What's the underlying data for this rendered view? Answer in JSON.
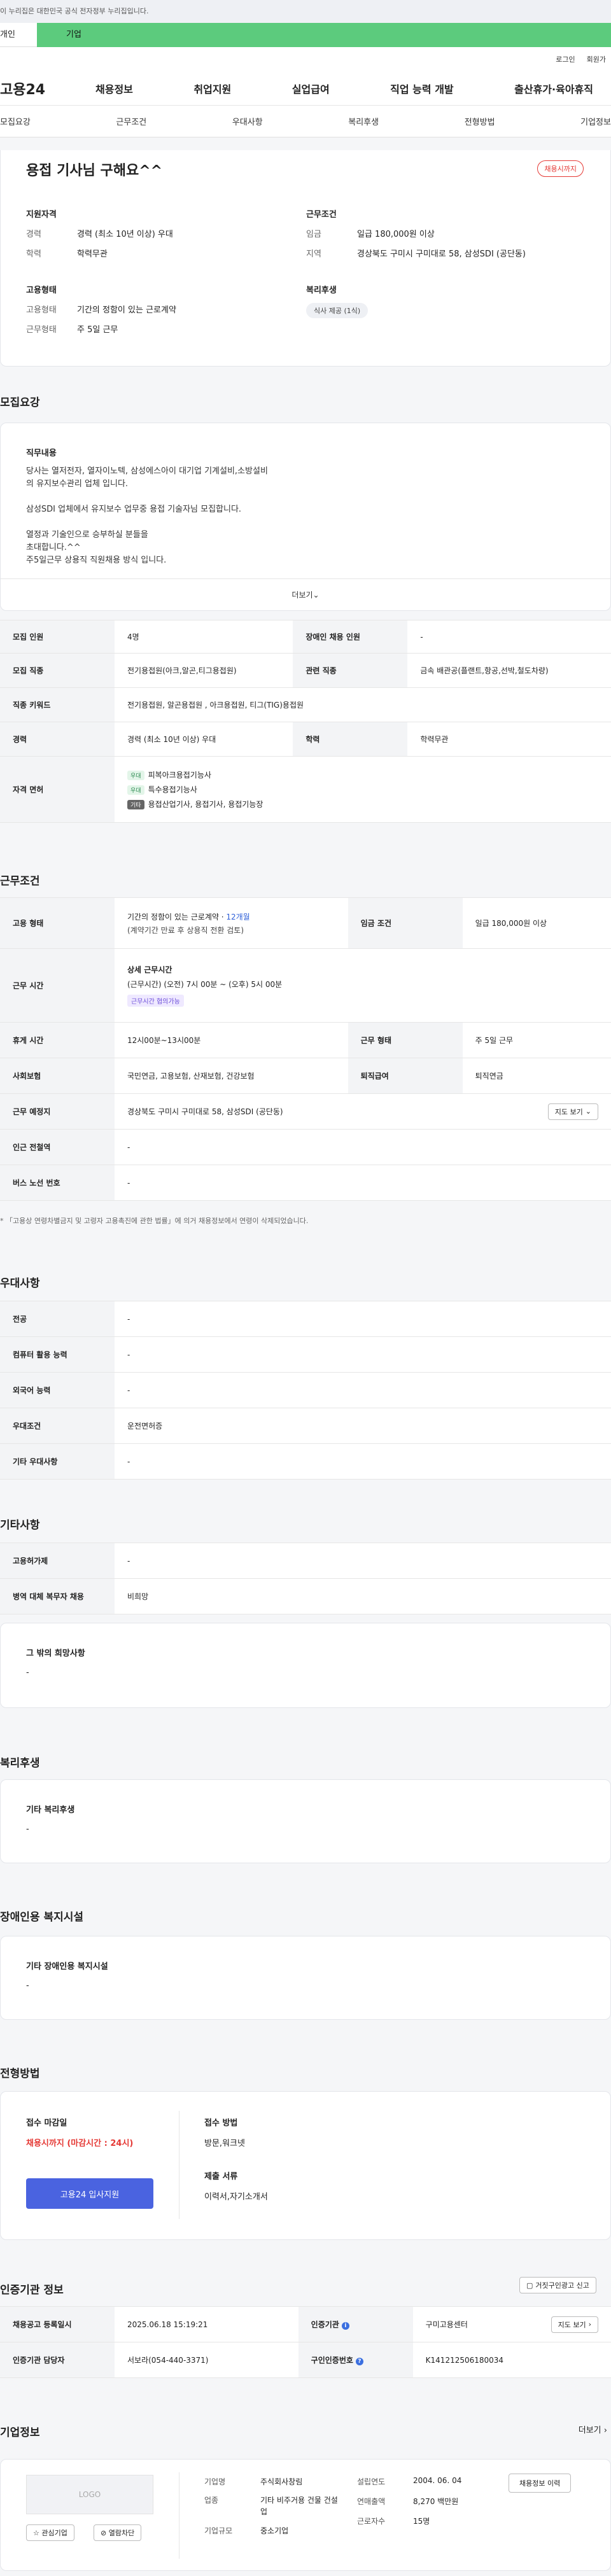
{
  "notice": "이 누리집은 대한민국 공식 전자정부 누리집입니다.",
  "tabs": {
    "individual": "개인",
    "company": "기업"
  },
  "util": {
    "login": "로그인",
    "join": "회원가"
  },
  "logo": "고용24",
  "gnb": [
    "채용정보",
    "취업지원",
    "실업급여",
    "직업 능력 개발",
    "출산휴가·육아휴직"
  ],
  "lnb": [
    "모집요강",
    "근무조건",
    "우대사항",
    "복리후생",
    "전형방법",
    "기업정보"
  ],
  "header": {
    "title": "용접 기사님 구해요^^",
    "status": "채용시까지",
    "qual_title": "지원자격",
    "qual": [
      {
        "k": "경력",
        "v": "경력 (최소 10년 이상) 우대"
      },
      {
        "k": "학력",
        "v": "학력무관"
      }
    ],
    "work_title": "근무조건",
    "work": [
      {
        "k": "임금",
        "v": "일급 180,000원 이상"
      },
      {
        "k": "지역",
        "v": "경상북도 구미시 구미대로 58, 삼성SDI (공단동)"
      }
    ],
    "emp_title": "고용형태",
    "emp": [
      {
        "k": "고용형태",
        "v": "기간의 정함이 있는 근로계약"
      },
      {
        "k": "근무형태",
        "v": "주 5일 근무"
      }
    ],
    "welfare_title": "복리후생",
    "welfare_chip": "식사 제공 (1식)"
  },
  "sections": {
    "recruit": "모집요강",
    "work": "근무조건",
    "prefer": "우대사항",
    "etc": "기타사항",
    "welfare": "복리후생",
    "disabled": "장애인용 복지시설",
    "apply": "전형방법",
    "cert": "인증기관 정보",
    "company": "기업정보"
  },
  "job_desc": {
    "title": "직무내용",
    "text": "당사는 열저전자, 열자이노텍, 삼성에스아이 대기업 기계설비,소방설비\n의 유지보수관리 업체 입니다.\n\n삼성SDI 업체에서 유지보수 업무중 용접 기술자님 모집합니다.\n\n열정과 기술인으로 승부하실 분들을\n초대합니다.^^\n주5일근무 상용직 직원채용 방식 입니다.",
    "more": "더보기"
  },
  "recruit_table": {
    "headcount_h": "모집 인원",
    "headcount": "4명",
    "disabled_h": "장애인 채용 인원",
    "disabled": "-",
    "job_h": "모집 직종",
    "job": "전기용접원(아크,알곤,티그용접원)",
    "rel_h": "관련 직종",
    "rel": "금속 배관공(플랜트,항공,선박,철도차량)",
    "kw_h": "직종 키워드",
    "kw": "전기용접원, 알곤용접원 , 아크용접원, 티그(TIG)용접원",
    "career_h": "경력",
    "career": "경력 (최소 10년 이상) 우대",
    "edu_h": "학력",
    "edu": "학력무관",
    "lic_h": "자격 면허",
    "lic": [
      {
        "tag": "우대",
        "name": "피복아크용접기능사"
      },
      {
        "tag": "우대",
        "name": "특수용접기능사"
      },
      {
        "tag": "기타",
        "name": "용접산업기사, 용접기사, 용접기능장"
      }
    ]
  },
  "work_table": {
    "type_h": "고용 형태",
    "type1": "기간의 정함이 있는 근로계약 · ",
    "type_months": "12개월",
    "type2": "(계약기간 만료 후 상용직 전환 검토)",
    "wage_h": "임금 조건",
    "wage": "일급 180,000원 이상",
    "time_h": "근무 시간",
    "time_title": "상세 근무시간",
    "time_detail": "(근무시간) (오전) 7시 00분 ~ (오후) 5시 00분",
    "time_tag": "근무시간 협의가능",
    "rest_h": "휴게 시간",
    "rest": "12시00분~13시00분",
    "form_h": "근무 형태",
    "form": "주 5일 근무",
    "ins_h": "사회보험",
    "ins": "국민연금, 고용보험, 산재보험, 건강보험",
    "retire_h": "퇴직급여",
    "retire": "퇴직연금",
    "place_h": "근무 예정지",
    "place": "경상북도 구미시 구미대로 58, 삼성SDI (공단동)",
    "map": "지도 보기",
    "subway_h": "인근 전철역",
    "subway": "-",
    "bus_h": "버스 노선 번호",
    "bus": "-"
  },
  "work_note": "* 「고용상 연령차별금지 및 고령자 고용촉진에 관한 법률」에 의거 채용정보에서 연령이 삭제되었습니다.",
  "prefer_table": {
    "major_h": "전공",
    "major": "-",
    "pc_h": "컴퓨터 활용 능력",
    "pc": "-",
    "lang_h": "외국어 능력",
    "lang": "-",
    "cond_h": "우대조건",
    "cond": "운전면허증",
    "other_h": "기타 우대사항",
    "other": "-"
  },
  "etc_table": {
    "disabled_h": "고용허가제",
    "disabled": "-",
    "military_h": "병역 대체 복무자 채용",
    "military": "비희망"
  },
  "etc_card": {
    "title": "그 밖의 희망사항",
    "value": "-"
  },
  "welfare_card": {
    "title": "기타 복리후생",
    "value": "-"
  },
  "disabled_card": {
    "title": "기타 장애인용 복지시설",
    "value": "-"
  },
  "apply": {
    "deadline_h": "접수 마감일",
    "deadline": "채용시까지 (마감시간 : 24시)",
    "btn": "고용24 입사지원",
    "method_h": "접수 방법",
    "method": "방문,워크넷",
    "docs_h": "제출 서류",
    "docs": "이력서,자기소개서"
  },
  "cert": {
    "report": "거짓구인광고 신고",
    "date_h": "채용공고 등록일시",
    "date": "2025.06.18 15:19:21",
    "org_h": "인증기관",
    "org": "구미고용센터",
    "map": "지도 보기",
    "mgr_h": "인증기관 담당자",
    "mgr": "서보라(054-440-3371)",
    "num_h": "구인인증번호",
    "num": "K141212506180034"
  },
  "company": {
    "more": "더보기",
    "logo": "LOGO",
    "fav": "관심기업",
    "block": "열람차단",
    "name_h": "기업명",
    "name": "주식회사창림",
    "ind_h": "업종",
    "ind": "기타 비주거용 건물 건설업",
    "size_h": "기업규모",
    "size": "중소기업",
    "est_h": "설립연도",
    "est": "2004. 06. 04",
    "sales_h": "연매출액",
    "sales": "8,270 백만원",
    "emp_h": "근로자수",
    "emp": "15명",
    "history": "채용정보 이력"
  }
}
